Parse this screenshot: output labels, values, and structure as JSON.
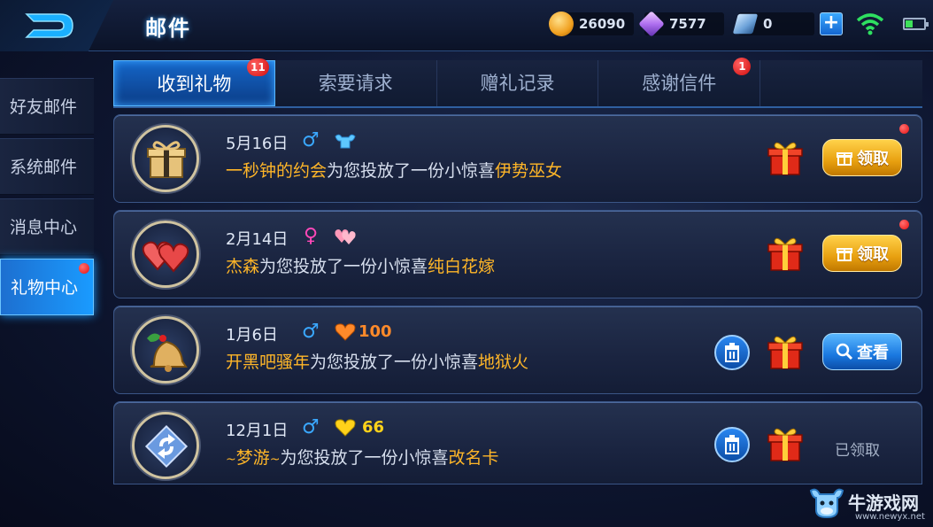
{
  "header": {
    "title": "邮件",
    "gold": "26090",
    "gems": "7577",
    "coupons": "0",
    "plus_label": "+"
  },
  "sidebar": {
    "items": [
      {
        "label": "好友邮件",
        "active": false,
        "dot": false
      },
      {
        "label": "系统邮件",
        "active": false,
        "dot": false
      },
      {
        "label": "消息中心",
        "active": false,
        "dot": false
      },
      {
        "label": "礼物中心",
        "active": true,
        "dot": true
      }
    ]
  },
  "tabs": [
    {
      "label": "收到礼物",
      "active": true,
      "badge": "11"
    },
    {
      "label": "索要请求",
      "active": false,
      "badge": ""
    },
    {
      "label": "赠礼记录",
      "active": false,
      "badge": ""
    },
    {
      "label": "感谢信件",
      "active": false,
      "badge": "1"
    },
    {
      "label": "",
      "active": false,
      "badge": ""
    }
  ],
  "mails": [
    {
      "date": "5月16日",
      "gender": "♂",
      "gender_color": "#3aa8ff",
      "extra_icon": "muscle-icon",
      "extra_value": "",
      "sender": "一秒钟的约会",
      "middle": "为您投放了一份小惊喜",
      "item": "伊势巫女",
      "action": "领取",
      "has_trash": false,
      "unread": true,
      "avatar": "gift-box-icon"
    },
    {
      "date": "2月14日",
      "gender": "♀",
      "gender_color": "#ff48b8",
      "extra_icon": "hearts-icon",
      "extra_value": "",
      "sender": "杰森",
      "middle": "为您投放了一份小惊喜",
      "item": "纯白花嫁",
      "action": "领取",
      "has_trash": false,
      "unread": true,
      "avatar": "double-heart-icon"
    },
    {
      "date": "1月6日",
      "gender": "♂",
      "gender_color": "#3aa8ff",
      "extra_icon": "heart-icon",
      "extra_value": "100",
      "sender": "开黑吧骚年",
      "middle": "为您投放了一份小惊喜",
      "item": "地狱火",
      "action": "查看",
      "has_trash": true,
      "unread": false,
      "avatar": "bell-icon"
    },
    {
      "date": "12月1日",
      "gender": "♂",
      "gender_color": "#3aa8ff",
      "extra_icon": "heart-icon",
      "extra_value": "66",
      "sender": "梦游",
      "middle": "为您投放了一份小惊喜",
      "item": "改名卡",
      "action": "已领取",
      "has_trash": true,
      "unread": false,
      "avatar": "rename-card-icon"
    }
  ],
  "watermark": {
    "name": "牛游戏网",
    "url": "www.newyx.net"
  },
  "colors": {
    "accent": "#1a9bff",
    "gold_text": "#ffb628",
    "badge_red": "#e81010"
  }
}
